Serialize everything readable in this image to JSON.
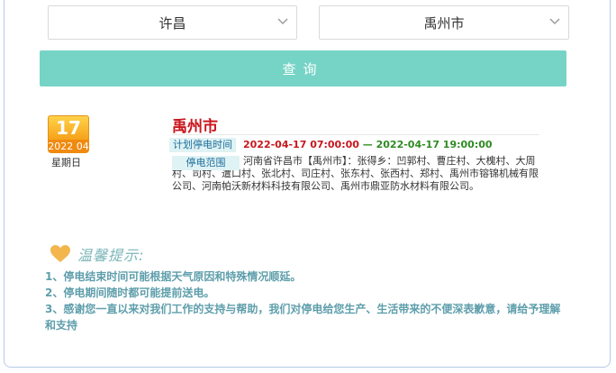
{
  "filters": {
    "city": "许昌",
    "county": "禹州市",
    "query_label": "查询"
  },
  "notice": {
    "day": "17",
    "year_month": "2022 04",
    "weekday": "星期日",
    "title": "禹州市",
    "time_label": "计划停电时间",
    "time_start": "2022-04-17 07:00:00",
    "time_sep": "—",
    "time_end": "2022-04-17 19:00:00",
    "range_label": "停电范围",
    "range_text": "河南省许昌市【禹州市】：张得乡：凹郭村、曹庄村、大槐村、大周村、司村、遭口村、张北村、司庄村、张东村、张西村、郑村、禹州市镕锦机械有限公司、河南帕沃新材料科技有限公司、禹州市鼎亚防水材料有限公司。"
  },
  "tips": {
    "title": "温馨提示:",
    "items": [
      "1、停电结束时间可能根据天气原因和特殊情况顺延。",
      "2、停电期间随时都可能提前送电。",
      "3、感谢您一直以来对我们工作的支持与帮助，我们对停电给您生产、生活带来的不便深表歉意，请给予理解和支持"
    ]
  },
  "colors": {
    "button": "#76d4c6",
    "title_red": "#c8171e",
    "time_green": "#2e8b22",
    "tip_text": "#5e9eab"
  },
  "icons": {
    "select_arrow": "chevron-down-icon",
    "calendar": "calendar-icon",
    "tips": "heart-icon"
  }
}
